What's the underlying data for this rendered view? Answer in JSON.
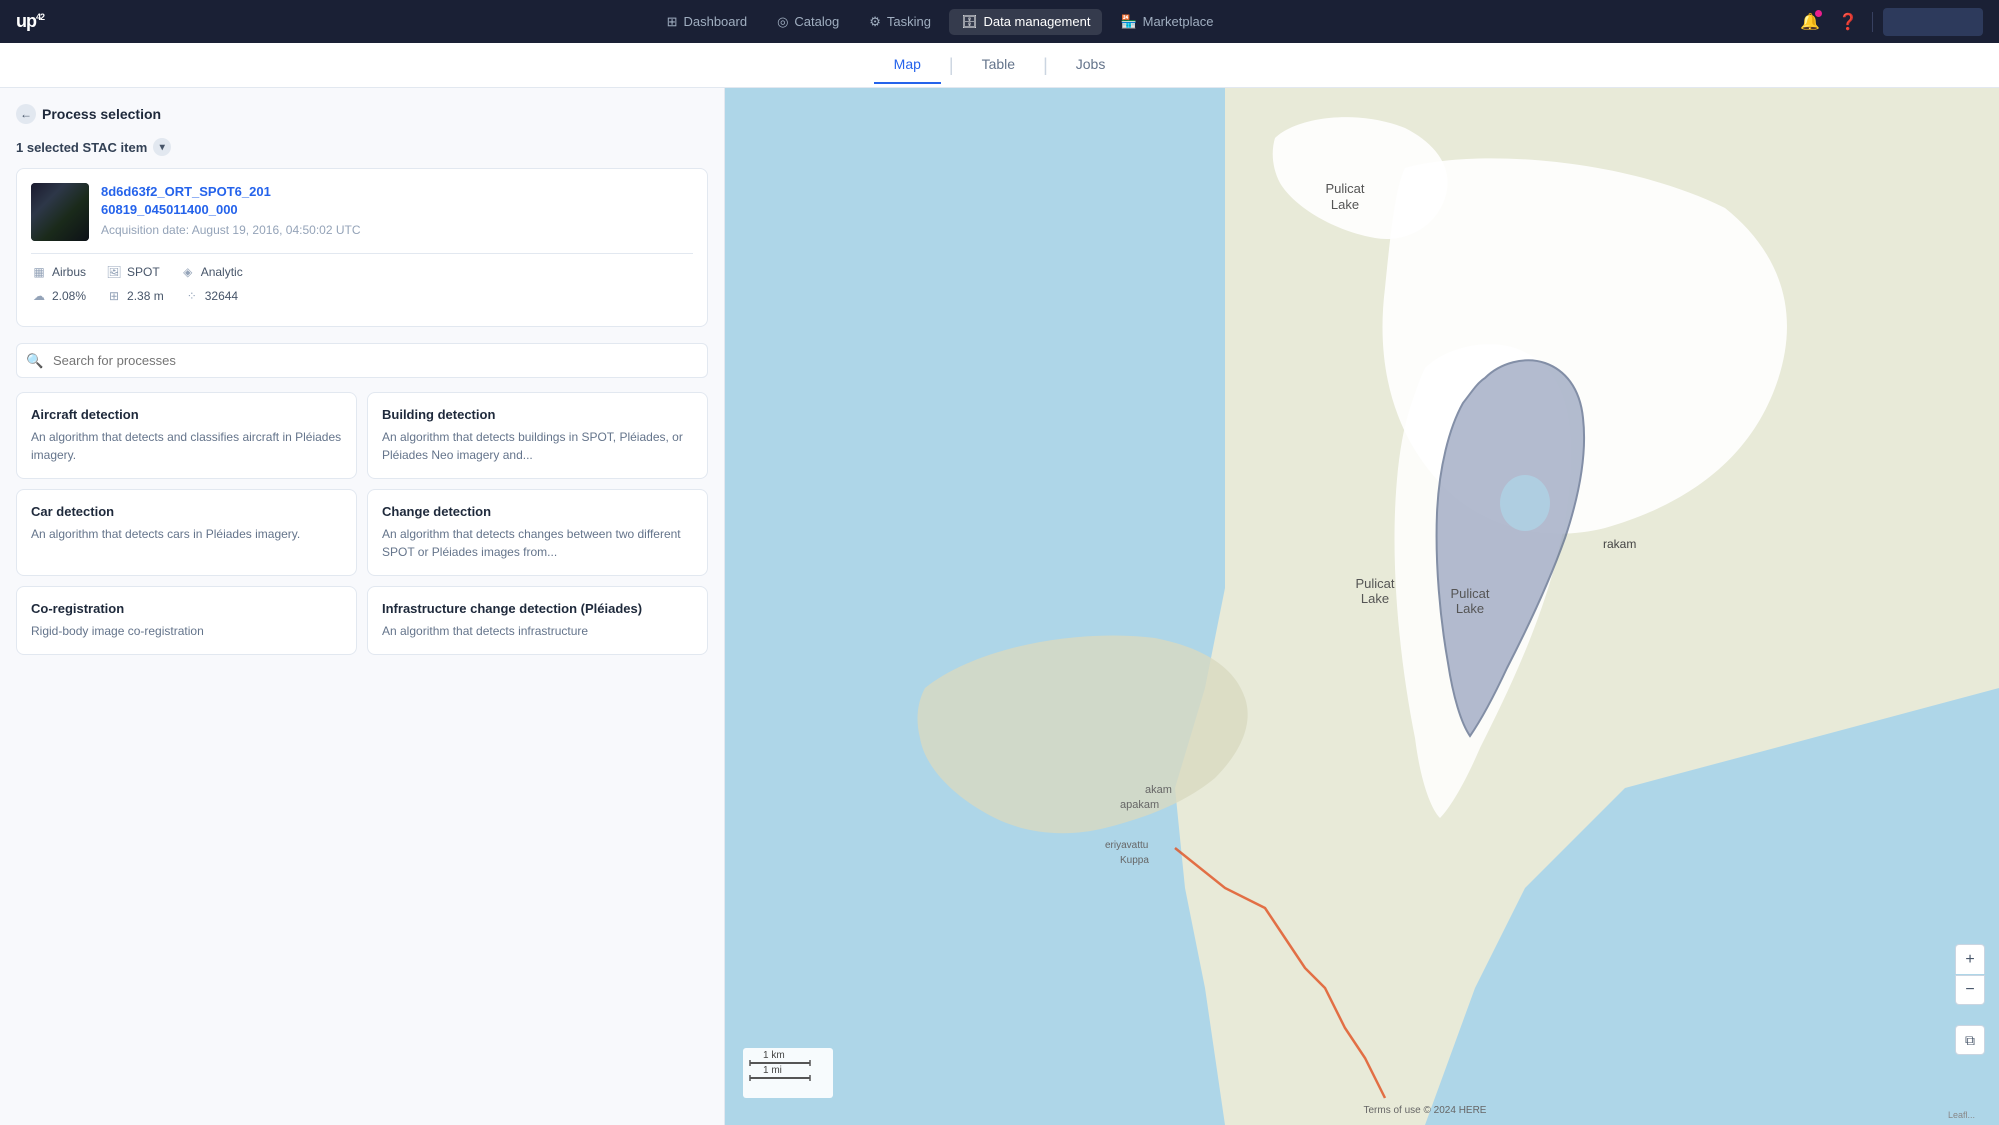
{
  "app": {
    "logo": "up42",
    "logo_sup": "42"
  },
  "nav": {
    "items": [
      {
        "id": "dashboard",
        "label": "Dashboard",
        "icon": "⊞",
        "active": false
      },
      {
        "id": "catalog",
        "label": "Catalog",
        "icon": "◎",
        "active": false
      },
      {
        "id": "tasking",
        "label": "Tasking",
        "icon": "⚙",
        "active": false
      },
      {
        "id": "data-management",
        "label": "Data management",
        "icon": "🗄",
        "active": true
      },
      {
        "id": "marketplace",
        "label": "Marketplace",
        "icon": "🏪",
        "active": false
      }
    ]
  },
  "secondary_nav": {
    "tabs": [
      {
        "id": "map",
        "label": "Map",
        "active": true
      },
      {
        "id": "table",
        "label": "Table",
        "active": false
      },
      {
        "id": "jobs",
        "label": "Jobs",
        "active": false
      }
    ]
  },
  "left_panel": {
    "back_button": "Process selection",
    "stac_section": "1 selected STAC item",
    "stac_card": {
      "id": "8d6d63f2_ORT_SPOT6_20160819_045011400_000",
      "id_display": "8d6d63f2_ORT_SPOT6_201\n60819_045011400_000",
      "acquisition_label": "Acquisition date:",
      "acquisition_date": "August 19, 2016, 04:50:02 UTC",
      "provider": "Airbus",
      "sensor": "SPOT",
      "type": "Analytic",
      "cloud_cover": "2.08%",
      "resolution": "2.38 m",
      "pixel_count": "32644"
    },
    "search_placeholder": "Search for processes",
    "processes": [
      {
        "id": "aircraft-detection",
        "title": "Aircraft detection",
        "description": "An algorithm that detects and classifies aircraft in Pléiades imagery."
      },
      {
        "id": "building-detection",
        "title": "Building detection",
        "description": "An algorithm that detects buildings in SPOT, Pléiades, or Pléiades Neo imagery and..."
      },
      {
        "id": "car-detection",
        "title": "Car detection",
        "description": "An algorithm that detects cars in Pléiades imagery."
      },
      {
        "id": "change-detection",
        "title": "Change detection",
        "description": "An algorithm that detects changes between two different SPOT or Pléiades images from..."
      },
      {
        "id": "co-registration",
        "title": "Co-registration",
        "description": "Rigid-body image co-registration"
      },
      {
        "id": "infrastructure-change-detection",
        "title": "Infrastructure change detection (Pléiades)",
        "description": "An algorithm that detects infrastructure"
      }
    ]
  },
  "map": {
    "zoom_in": "+",
    "zoom_out": "−",
    "layers_icon": "⧉",
    "attribution": "Terms of use  © 2024 HERE",
    "scale_km": "1 km",
    "scale_mi": "1 mi",
    "location_label": "Pulicat Lake",
    "sub_location": "rakam"
  }
}
